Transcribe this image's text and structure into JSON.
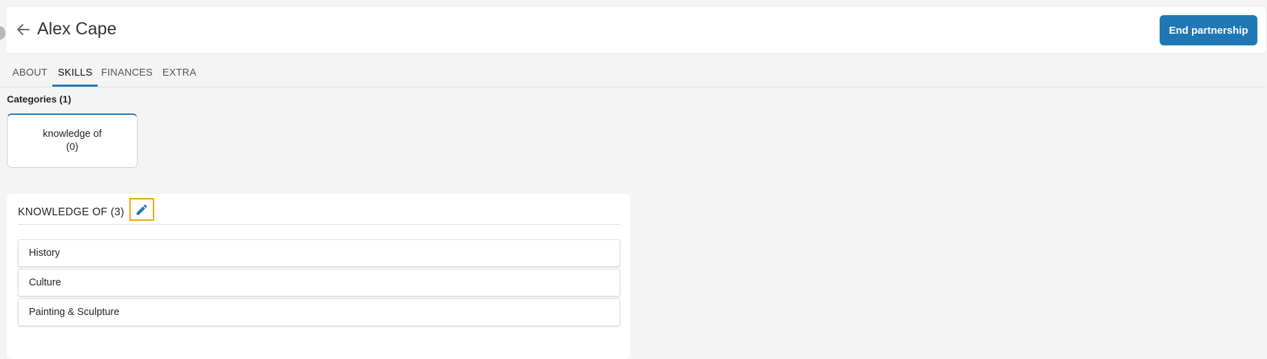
{
  "header": {
    "title": "Alex Cape",
    "end_partnership_label": "End partnership",
    "accent_color": "#1f78b4"
  },
  "tabs": [
    {
      "label": "ABOUT",
      "active": false
    },
    {
      "label": "SKILLS",
      "active": true
    },
    {
      "label": "FINANCES",
      "active": false
    },
    {
      "label": "EXTRA",
      "active": false
    }
  ],
  "categories": {
    "label": "Categories (1)",
    "items": [
      {
        "name": "knowledge of",
        "count": "(0)"
      }
    ]
  },
  "skills_panel": {
    "title": "KNOWLEDGE OF (3)",
    "items": [
      {
        "label": "History"
      },
      {
        "label": "Culture"
      },
      {
        "label": "Painting & Sculpture"
      }
    ],
    "edit_icon": "pencil-icon",
    "highlight_color": "#f0a400"
  }
}
